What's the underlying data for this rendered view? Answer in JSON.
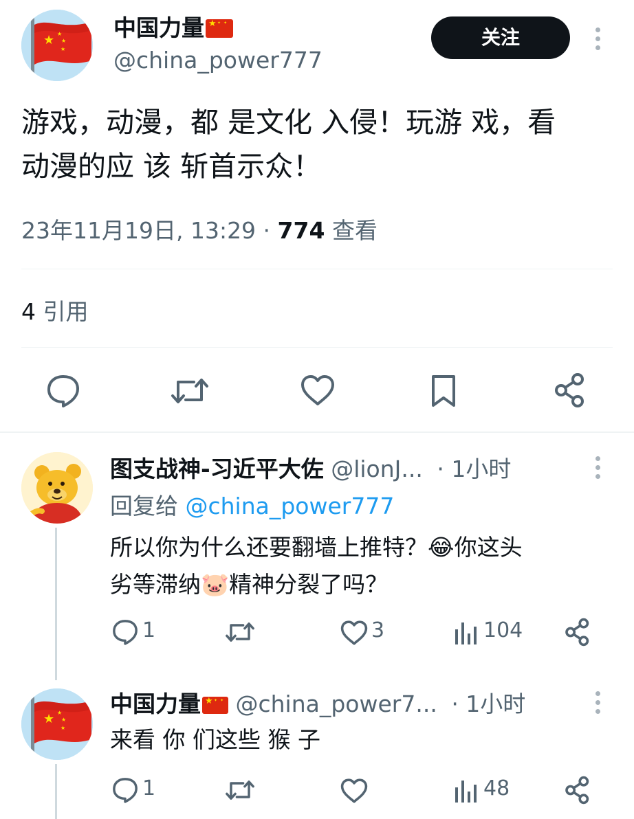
{
  "main_tweet": {
    "display_name": "中国力量",
    "handle": "@china_power777",
    "follow_label": "关注",
    "text_line1": "游戏，动漫，都 是文化 入侵！玩游 戏，看",
    "text_line2": "动漫的应 该 斩首示众！",
    "timestamp": "23年11月19日, 13:29",
    "separator": " · ",
    "views_count": "774",
    "views_label": "查看",
    "quotes_count": "4",
    "quotes_label": "引用"
  },
  "replies": [
    {
      "display_name": "图支战神-习近平大佐",
      "handle": "@lionJ...",
      "time": "· 1小时",
      "reply_to_label": "回复给",
      "reply_to_handle": "@china_power777",
      "text_line1_a": "所以你为什么还要翻墙上推特？",
      "text_line1_b": "你这头",
      "text_line2_a": "劣等滞纳",
      "text_line2_b": "精神分裂了吗？",
      "emoji1": "😂",
      "emoji2": "🐷",
      "reply_count": "1",
      "retweet_count": "",
      "like_count": "3",
      "view_count": "104"
    },
    {
      "display_name": "中国力量",
      "handle": "@china_power7...",
      "time": "· 1小时",
      "text_line1": "来看 你 们这些 猴 子",
      "reply_count": "1",
      "retweet_count": "",
      "like_count": "",
      "view_count": "48"
    }
  ],
  "colors": {
    "text": "#0f1419",
    "muted": "#536471",
    "link": "#1d9bf0",
    "flag_red": "#de2910",
    "flag_yellow": "#ffde00",
    "divider": "#eff3f4"
  }
}
